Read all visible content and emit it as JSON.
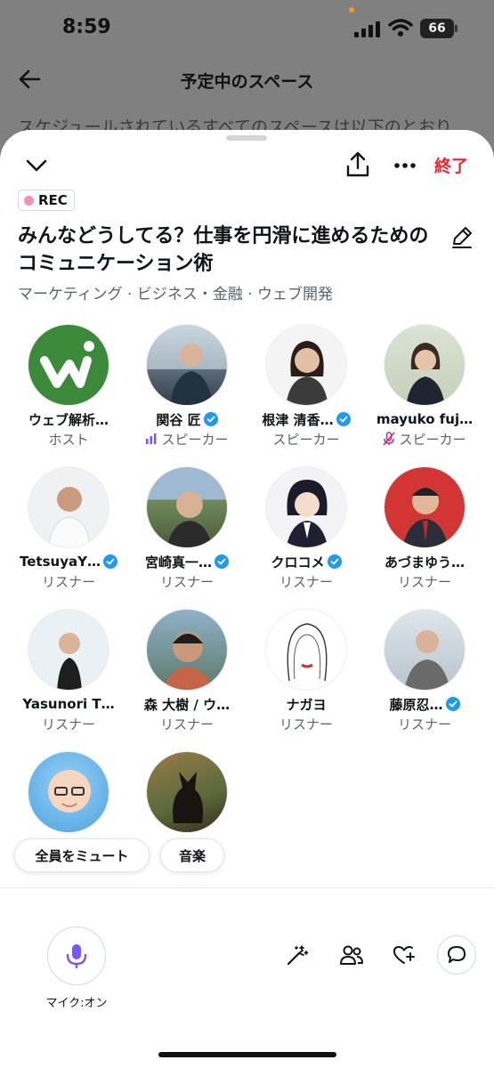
{
  "status_bar": {
    "time": "8:59",
    "battery": "66"
  },
  "background_page": {
    "title": "予定中のスペース",
    "body_text": "スケジュールされているすべてのスペースは以下のとおり"
  },
  "sheet": {
    "end_label": "終了",
    "rec_label": "REC",
    "title": "みんなどうしてる？仕事を円滑に進めるためのコミュニケーション術",
    "topics": "マーケティング · ビジネス・金融 · ウェブ開発",
    "participants": [
      {
        "name": "ウェブ解析…",
        "role": "ホスト",
        "verified": false
      },
      {
        "name": "関谷 匠",
        "role": "スピーカー",
        "verified": true,
        "role_icon": "speaking-bars-icon"
      },
      {
        "name": "根津 清香…",
        "role": "スピーカー",
        "verified": true
      },
      {
        "name": "mayuko fuj…",
        "role": "スピーカー",
        "verified": false,
        "role_icon": "mic-muted-icon"
      },
      {
        "name": "TetsuyaY…",
        "role": "リスナー",
        "verified": true
      },
      {
        "name": "宮崎真一…",
        "role": "リスナー",
        "verified": true
      },
      {
        "name": "クロコメ",
        "role": "リスナー",
        "verified": true
      },
      {
        "name": "あづまゆう…",
        "role": "リスナー",
        "verified": false
      },
      {
        "name": "Yasunori T…",
        "role": "リスナー",
        "verified": false
      },
      {
        "name": "森 大樹 / ウ…",
        "role": "リスナー",
        "verified": false
      },
      {
        "name": "ナガヨ",
        "role": "リスナー",
        "verified": false
      },
      {
        "name": "藤原忍…",
        "role": "リスナー",
        "verified": true
      },
      {
        "name": "",
        "role": "",
        "verified": false
      },
      {
        "name": "",
        "role": "",
        "verified": false
      }
    ],
    "pills": {
      "mute_all": "全員をミュート",
      "music": "音楽"
    },
    "mic_label": "マイク:オン"
  },
  "colors": {
    "accent": "#1d9bf0",
    "end_red": "#f4212e",
    "mic_purple": "#7856ff",
    "rec_pink": "#f78fb3"
  }
}
